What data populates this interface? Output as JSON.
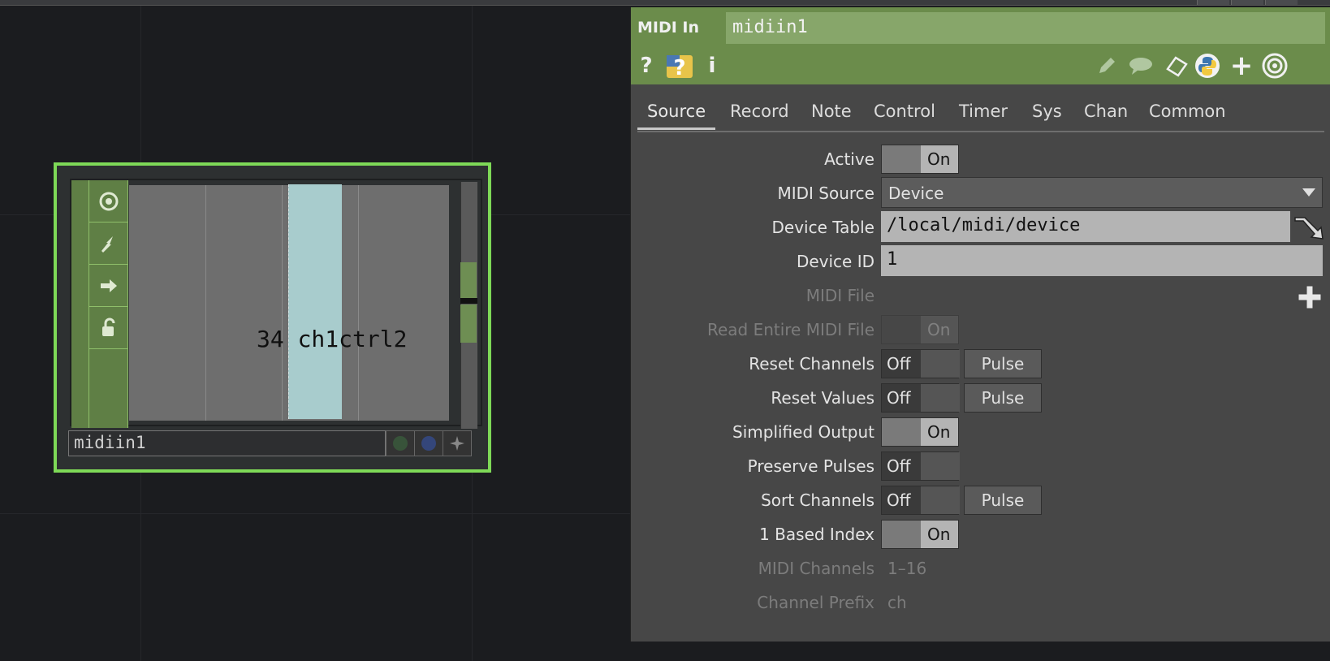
{
  "node": {
    "name": "midiin1",
    "viewer_value": "34",
    "viewer_channel": "ch1ctrl2"
  },
  "panel": {
    "op_type": "MIDI In",
    "op_name": "midiin1",
    "tabs": [
      "Source",
      "Record",
      "Note",
      "Control",
      "Timer",
      "Sys",
      "Chan",
      "Common"
    ],
    "params": {
      "active": {
        "label": "Active",
        "value": "On"
      },
      "midi_source": {
        "label": "MIDI Source",
        "value": "Device"
      },
      "device_table": {
        "label": "Device Table",
        "value": "/local/midi/device"
      },
      "device_id": {
        "label": "Device ID",
        "value": "1"
      },
      "midi_file": {
        "label": "MIDI File",
        "value": ""
      },
      "read_entire": {
        "label": "Read Entire MIDI File",
        "value": "On"
      },
      "reset_channels": {
        "label": "Reset Channels",
        "value": "Off",
        "pulse": "Pulse"
      },
      "reset_values": {
        "label": "Reset Values",
        "value": "Off",
        "pulse": "Pulse"
      },
      "simplified_output": {
        "label": "Simplified Output",
        "value": "On"
      },
      "preserve_pulses": {
        "label": "Preserve Pulses",
        "value": "Off"
      },
      "sort_channels": {
        "label": "Sort Channels",
        "value": "Off",
        "pulse": "Pulse"
      },
      "one_based": {
        "label": "1 Based Index",
        "value": "On"
      },
      "midi_channels": {
        "label": "MIDI Channels",
        "value": "1–16"
      },
      "channel_prefix": {
        "label": "Channel Prefix",
        "value": "ch"
      }
    }
  },
  "icons": [
    "help-icon",
    "python-help-icon",
    "info-icon",
    "edit-icon",
    "comment-icon",
    "clone-icon",
    "python-icon",
    "add-icon",
    "target-icon"
  ],
  "colors": {
    "node_outline": "#7ed957",
    "header_green": "#6b8c4b",
    "viewer_bar": "#a8cccd"
  }
}
